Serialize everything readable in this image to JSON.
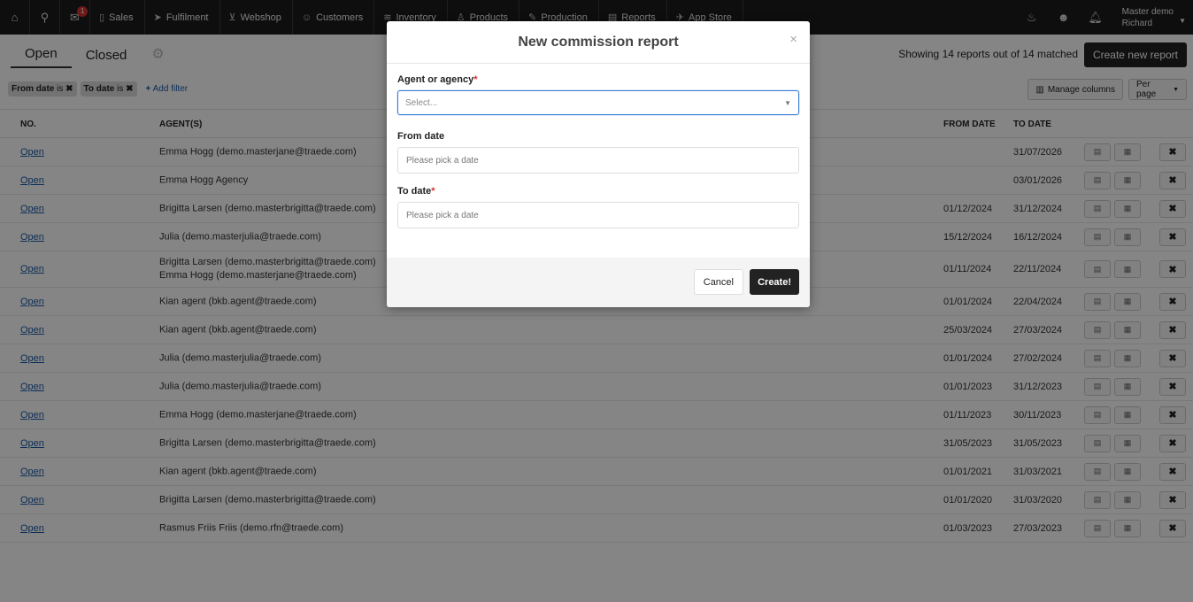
{
  "nav": {
    "badge_count": "1",
    "items": [
      {
        "label": "Sales",
        "icon": "document-icon"
      },
      {
        "label": "Fulfilment",
        "icon": "send-icon"
      },
      {
        "label": "Webshop",
        "icon": "cart-icon"
      },
      {
        "label": "Customers",
        "icon": "users-icon"
      },
      {
        "label": "Inventory",
        "icon": "layers-icon"
      },
      {
        "label": "Products",
        "icon": "shirt-icon"
      },
      {
        "label": "Production",
        "icon": "pen-icon"
      },
      {
        "label": "Reports",
        "icon": "chart-icon"
      },
      {
        "label": "App Store",
        "icon": "rocket-icon"
      }
    ],
    "user_line1": "Master demo",
    "user_line2": "Richard"
  },
  "tabs": {
    "open": "Open",
    "closed": "Closed"
  },
  "showing_text": "Showing 14 reports out of 14 matched",
  "create_new_label": "Create new report",
  "filters": {
    "chip1_name": "From date",
    "chip1_op": "is",
    "chip2_name": "To date",
    "chip2_op": "is",
    "add_filter": "Add filter"
  },
  "manage_columns": "Manage columns",
  "per_page": "Per page",
  "table": {
    "headers": {
      "no": "NO.",
      "agents": "AGENT(S)",
      "from": "FROM DATE",
      "to": "TO DATE"
    },
    "rows": [
      {
        "open": "Open",
        "agents": [
          "Emma Hogg (demo.masterjane@traede.com)"
        ],
        "from": "",
        "to": "31/07/2026"
      },
      {
        "open": "Open",
        "agents": [
          "Emma Hogg Agency"
        ],
        "from": "",
        "to": "03/01/2026"
      },
      {
        "open": "Open",
        "agents": [
          "Brigitta Larsen (demo.masterbrigitta@traede.com)"
        ],
        "from": "01/12/2024",
        "to": "31/12/2024"
      },
      {
        "open": "Open",
        "agents": [
          "Julia (demo.masterjulia@traede.com)"
        ],
        "from": "15/12/2024",
        "to": "16/12/2024"
      },
      {
        "open": "Open",
        "agents": [
          "Brigitta Larsen (demo.masterbrigitta@traede.com)",
          "Emma Hogg (demo.masterjane@traede.com)"
        ],
        "from": "01/11/2024",
        "to": "22/11/2024"
      },
      {
        "open": "Open",
        "agents": [
          "Kian agent (bkb.agent@traede.com)"
        ],
        "from": "01/01/2024",
        "to": "22/04/2024"
      },
      {
        "open": "Open",
        "agents": [
          "Kian agent (bkb.agent@traede.com)"
        ],
        "from": "25/03/2024",
        "to": "27/03/2024"
      },
      {
        "open": "Open",
        "agents": [
          "Julia (demo.masterjulia@traede.com)"
        ],
        "from": "01/01/2024",
        "to": "27/02/2024"
      },
      {
        "open": "Open",
        "agents": [
          "Julia (demo.masterjulia@traede.com)"
        ],
        "from": "01/01/2023",
        "to": "31/12/2023"
      },
      {
        "open": "Open",
        "agents": [
          "Emma Hogg (demo.masterjane@traede.com)"
        ],
        "from": "01/11/2023",
        "to": "30/11/2023"
      },
      {
        "open": "Open",
        "agents": [
          "Brigitta Larsen (demo.masterbrigitta@traede.com)"
        ],
        "from": "31/05/2023",
        "to": "31/05/2023"
      },
      {
        "open": "Open",
        "agents": [
          "Kian agent (bkb.agent@traede.com)"
        ],
        "from": "01/01/2021",
        "to": "31/03/2021"
      },
      {
        "open": "Open",
        "agents": [
          "Brigitta Larsen (demo.masterbrigitta@traede.com)"
        ],
        "from": "01/01/2020",
        "to": "31/03/2020"
      },
      {
        "open": "Open",
        "agents": [
          "Rasmus Friis Friis (demo.rfn@traede.com)"
        ],
        "from": "01/03/2023",
        "to": "27/03/2023"
      }
    ]
  },
  "modal": {
    "title": "New commission report",
    "agent_label": "Agent or agency",
    "agent_placeholder": "Select...",
    "from_label": "From date",
    "from_placeholder": "Please pick a date",
    "to_label": "To date",
    "to_placeholder": "Please pick a date",
    "cancel": "Cancel",
    "create": "Create!",
    "required_mark": "*"
  }
}
